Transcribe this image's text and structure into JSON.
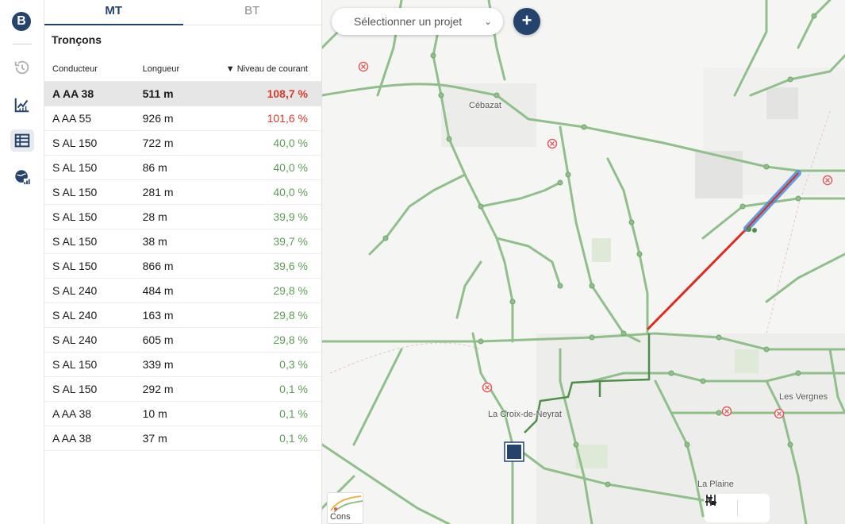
{
  "app": {
    "logo_letter": "B"
  },
  "rail": {
    "items": [
      {
        "name": "history-icon",
        "active": false
      },
      {
        "name": "chart-line-icon",
        "active": false
      },
      {
        "name": "table-icon",
        "active": true
      },
      {
        "name": "globe-stats-icon",
        "active": false
      }
    ]
  },
  "tabs": [
    {
      "label": "MT",
      "active": true
    },
    {
      "label": "BT",
      "active": false
    }
  ],
  "section": {
    "title": "Tronçons"
  },
  "table": {
    "headers": {
      "conductor": "Conducteur",
      "length": "Longueur",
      "current": "▼ Niveau de courant"
    },
    "rows": [
      {
        "conductor": "A AA 38",
        "length": "511 m",
        "current": "108,7 %",
        "level": "red",
        "selected": true
      },
      {
        "conductor": "A AA 55",
        "length": "926 m",
        "current": "101,6 %",
        "level": "red",
        "selected": false
      },
      {
        "conductor": "S AL 150",
        "length": "722 m",
        "current": "40,0 %",
        "level": "green",
        "selected": false
      },
      {
        "conductor": "S AL 150",
        "length": "86 m",
        "current": "40,0 %",
        "level": "green",
        "selected": false
      },
      {
        "conductor": "S AL 150",
        "length": "281 m",
        "current": "40,0 %",
        "level": "green",
        "selected": false
      },
      {
        "conductor": "S AL 150",
        "length": "28 m",
        "current": "39,9 %",
        "level": "green",
        "selected": false
      },
      {
        "conductor": "S AL 150",
        "length": "38 m",
        "current": "39,7 %",
        "level": "green",
        "selected": false
      },
      {
        "conductor": "S AL 150",
        "length": "866 m",
        "current": "39,6 %",
        "level": "green",
        "selected": false
      },
      {
        "conductor": "S AL 240",
        "length": "484 m",
        "current": "29,8 %",
        "level": "green",
        "selected": false
      },
      {
        "conductor": "S AL 240",
        "length": "163 m",
        "current": "29,8 %",
        "level": "green",
        "selected": false
      },
      {
        "conductor": "S AL 240",
        "length": "605 m",
        "current": "29,8 %",
        "level": "green",
        "selected": false
      },
      {
        "conductor": "S AL 150",
        "length": "339 m",
        "current": "0,3 %",
        "level": "green",
        "selected": false
      },
      {
        "conductor": "S AL 150",
        "length": "292 m",
        "current": "0,1 %",
        "level": "green",
        "selected": false
      },
      {
        "conductor": "A AA 38",
        "length": "10 m",
        "current": "0,1 %",
        "level": "green",
        "selected": false
      },
      {
        "conductor": "A AA 38",
        "length": "37 m",
        "current": "0,1 %",
        "level": "green",
        "selected": false
      }
    ]
  },
  "map": {
    "project_select": {
      "placeholder": "Sélectionner un projet"
    },
    "add_button": "+",
    "places": {
      "cebazat": "Cébazat",
      "croix_de_neyrat": "La Croix-de-Neyrat",
      "les_vergnes": "Les Vergnes",
      "la_plaine": "La Plaine"
    },
    "legend_thumb_label": "Cons",
    "colors": {
      "network": "#8fc08a",
      "network_dark": "#4f8f4a",
      "overload": "#e02a1e",
      "selected": "#4a90d9",
      "brand": "#24446e"
    }
  }
}
